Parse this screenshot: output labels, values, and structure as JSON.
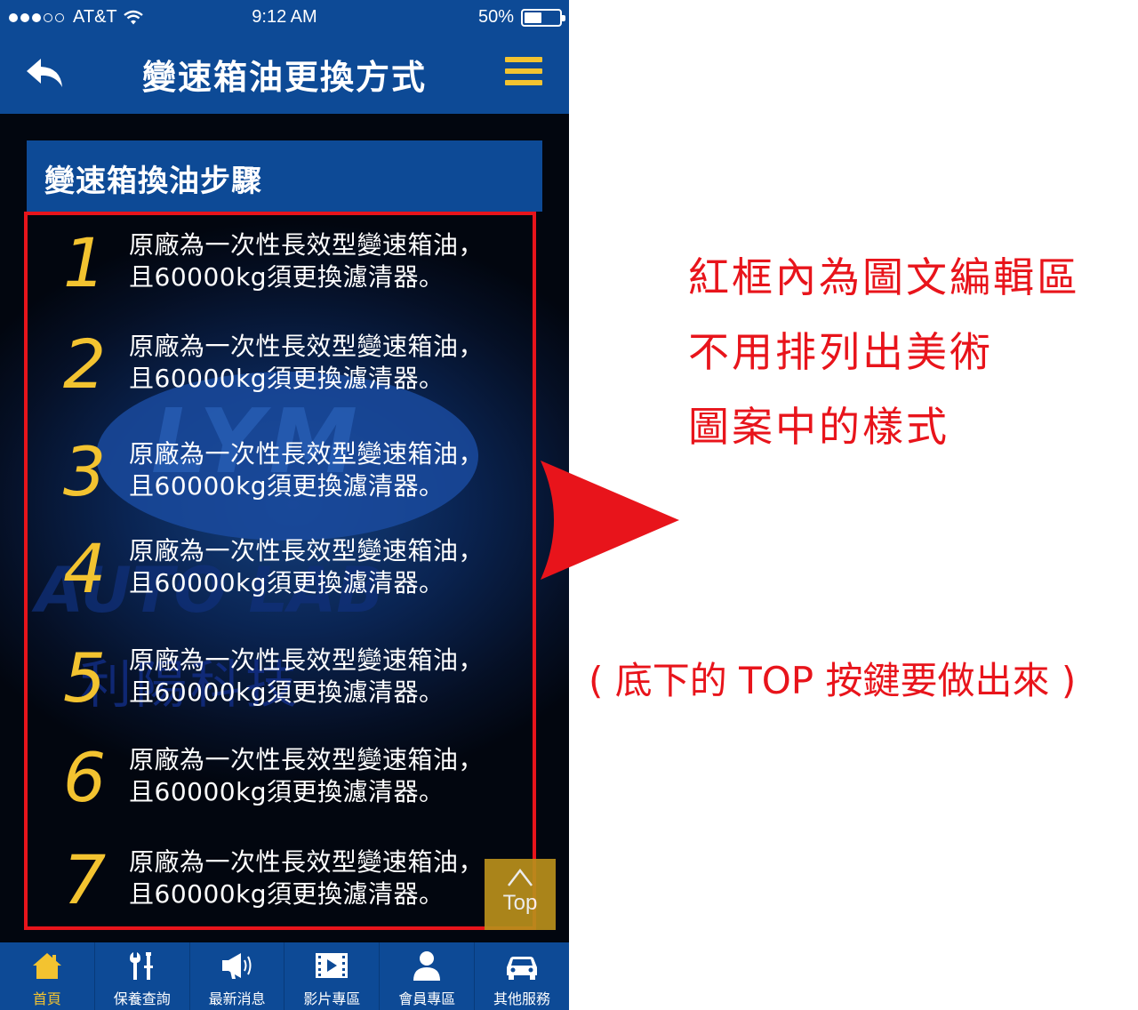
{
  "status_bar": {
    "carrier": "AT&T",
    "time": "9:12 AM",
    "battery_percent": "50%",
    "battery_level": 0.5
  },
  "nav": {
    "title": "變速箱油更換方式",
    "back_icon": "back-arrow-icon",
    "menu_icon": "hamburger-menu-icon"
  },
  "section": {
    "title": "變速箱換油步驟"
  },
  "background": {
    "logo_text": "LYM",
    "logo_sub": "AUTO LAB",
    "watermark": "利陽科技"
  },
  "steps": [
    {
      "num": "1",
      "line1": "原廠為一次性長效型變速箱油，",
      "line2": "且60000kg須更換濾清器。"
    },
    {
      "num": "2",
      "line1": "原廠為一次性長效型變速箱油，",
      "line2": "且60000kg須更換濾清器。"
    },
    {
      "num": "3",
      "line1": "原廠為一次性長效型變速箱油，",
      "line2": "且60000kg須更換濾清器。"
    },
    {
      "num": "4",
      "line1": "原廠為一次性長效型變速箱油，",
      "line2": "且60000kg須更換濾清器。"
    },
    {
      "num": "5",
      "line1": "原廠為一次性長效型變速箱油，",
      "line2": "且60000kg須更換濾清器。"
    },
    {
      "num": "6",
      "line1": "原廠為一次性長效型變速箱油，",
      "line2": "且60000kg須更換濾清器。"
    },
    {
      "num": "7",
      "line1": "原廠為一次性長效型變速箱油，",
      "line2": "且60000kg須更換濾清器。"
    }
  ],
  "top_button": {
    "label": "Top",
    "icon": "chevron-up-icon"
  },
  "tabs": [
    {
      "label": "首頁",
      "icon": "home-icon",
      "active": true
    },
    {
      "label": "保養查詢",
      "icon": "tools-icon",
      "active": false
    },
    {
      "label": "最新消息",
      "icon": "megaphone-icon",
      "active": false
    },
    {
      "label": "影片專區",
      "icon": "video-icon",
      "active": false
    },
    {
      "label": "會員專區",
      "icon": "person-icon",
      "active": false
    },
    {
      "label": "其他服務",
      "icon": "car-icon",
      "active": false
    }
  ],
  "annotations": {
    "line1": "紅框內為圖文編輯區",
    "line2": "不用排列出美術",
    "line3": "圖案中的樣式",
    "note": "( 底下的 TOP 按鍵要做出來 )"
  },
  "colors": {
    "nav_blue": "#0d4a96",
    "accent_yellow": "#f3c330",
    "annotation_red": "#e8141b",
    "top_button": "#b98f1b"
  }
}
